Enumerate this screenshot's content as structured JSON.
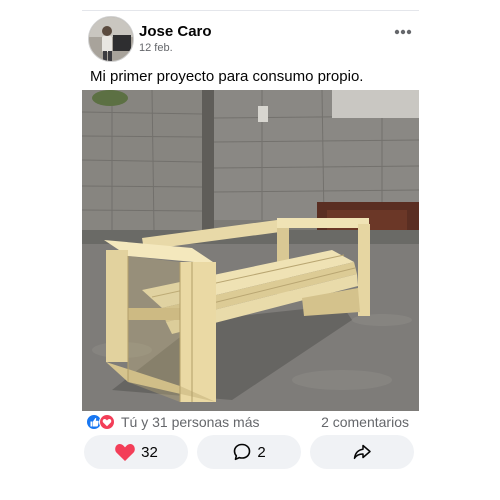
{
  "post": {
    "author": "Jose Caro",
    "date": "12 feb.",
    "caption": "Mi primer proyecto para consumo propio."
  },
  "reactions": {
    "summary": "Tú y 31 personas más",
    "comments": "2 comentarios",
    "icons": [
      "like-icon",
      "love-icon"
    ]
  },
  "actions": {
    "like_count": "32",
    "comment_count": "2"
  },
  "colors": {
    "like_blue": "#1877f2",
    "love_red": "#f33e58",
    "button_bg": "#f0f2f5",
    "secondary_text": "#65676b"
  }
}
